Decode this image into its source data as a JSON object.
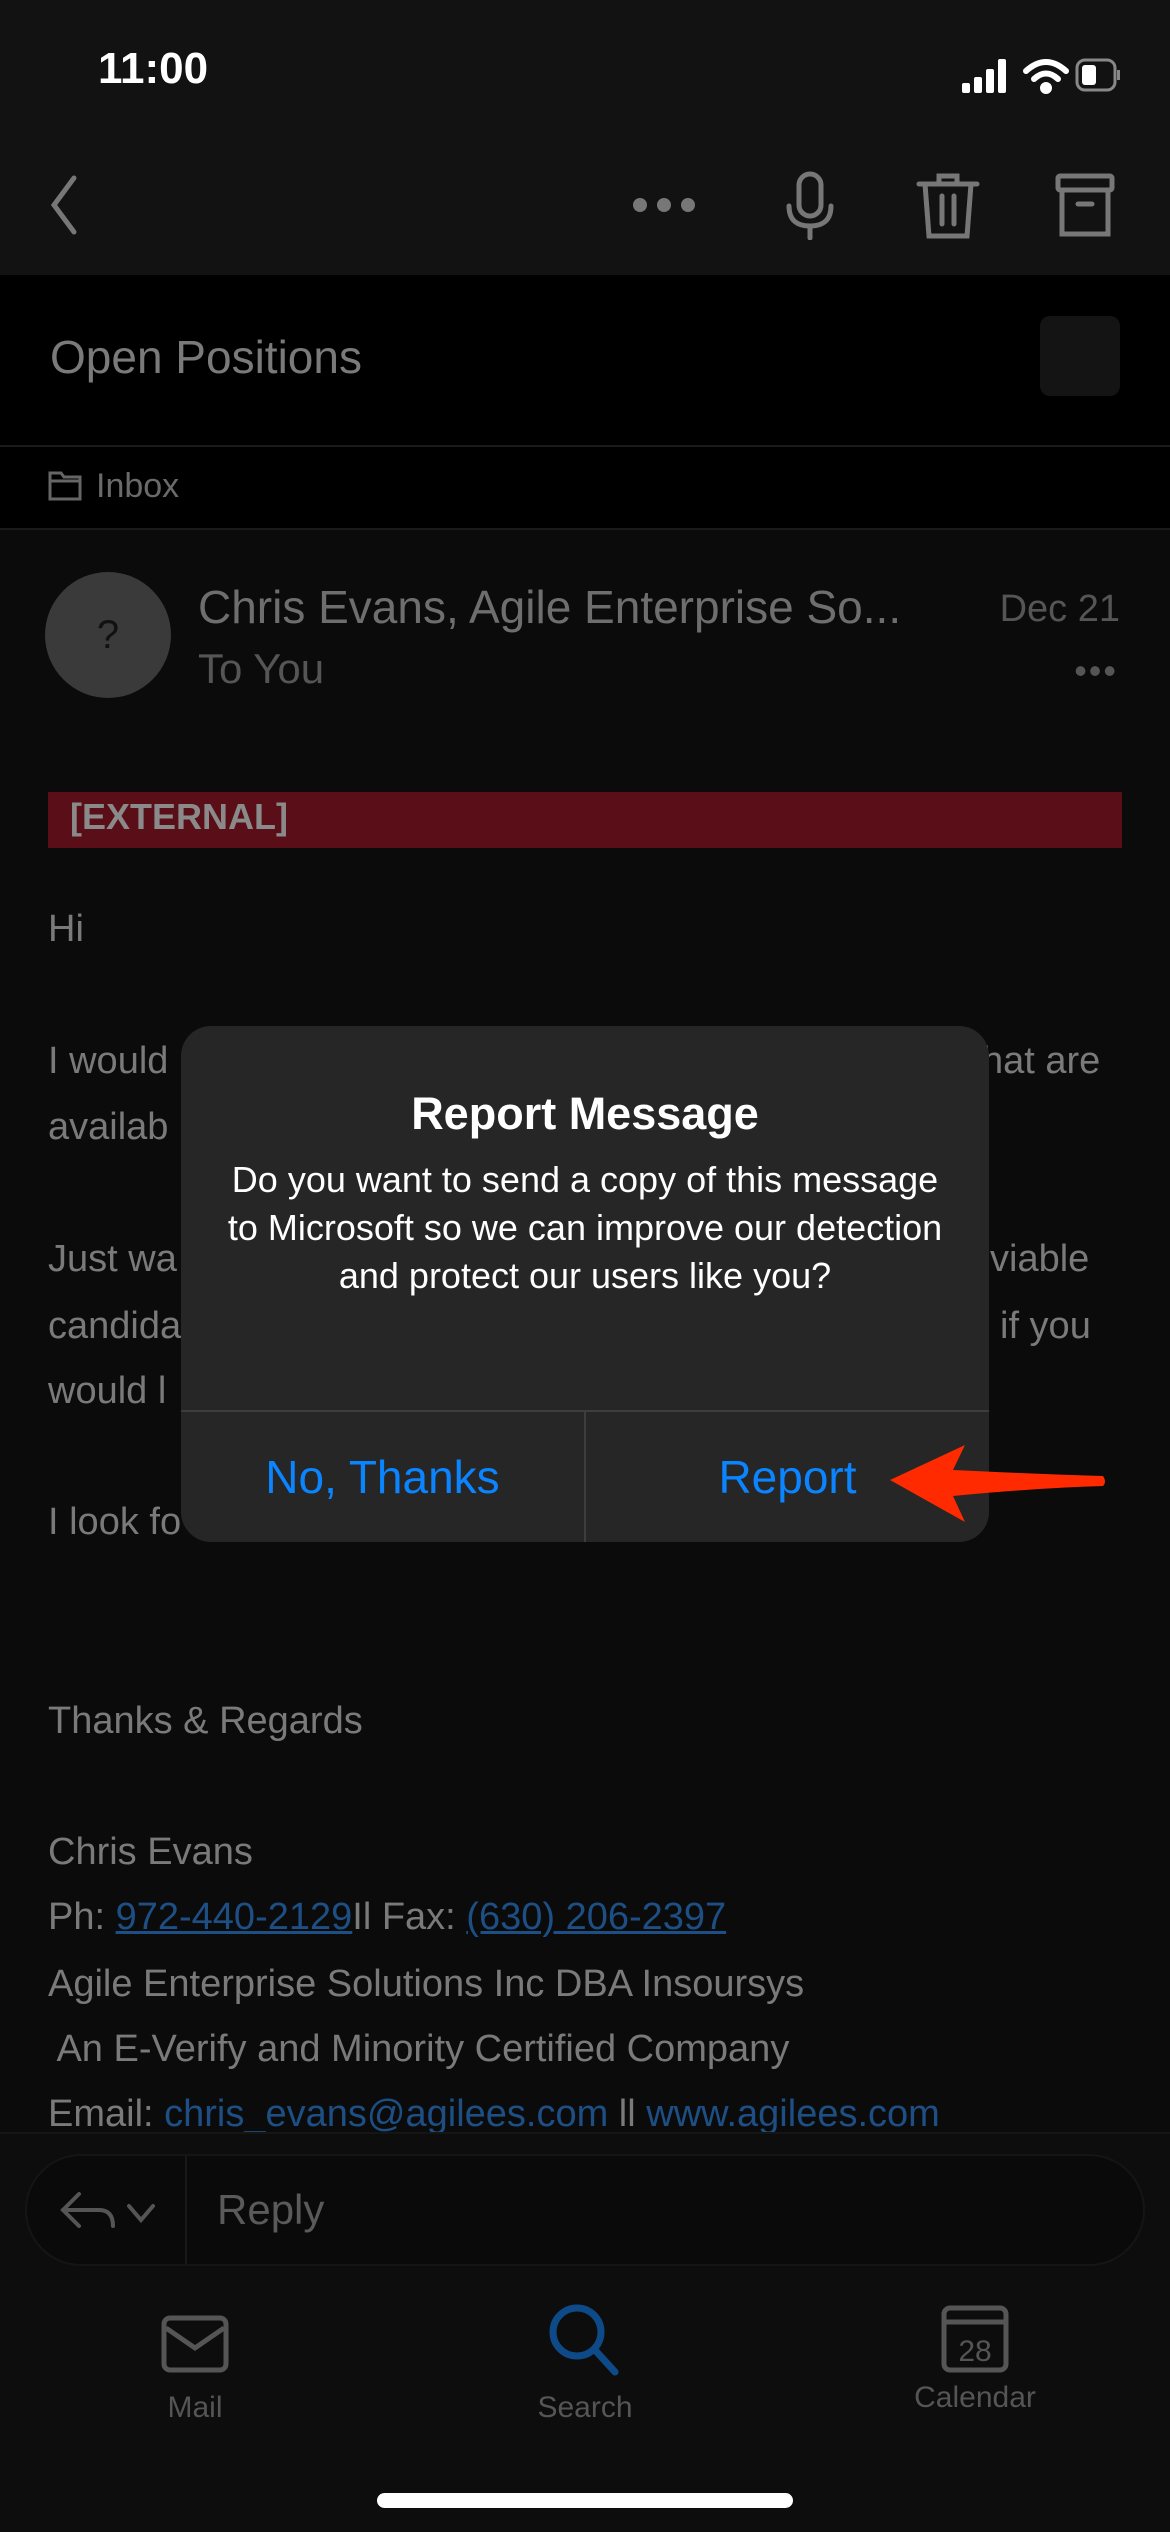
{
  "status_bar": {
    "time": "11:00",
    "icons": [
      "cellular-signal-icon",
      "wifi-icon",
      "battery-icon"
    ]
  },
  "toolbar": {
    "icons": [
      "back-chevron-icon",
      "more-icon",
      "microphone-icon",
      "trash-icon",
      "archive-icon"
    ]
  },
  "subject": "Open Positions",
  "folder": "Inbox",
  "message": {
    "avatar": "?",
    "sender": "Chris Evans, Agile Enterprise So...",
    "recipient": "To You",
    "date": "Dec 21",
    "more": "•••",
    "external_tag": "[EXTERNAL]",
    "body_left": [
      "Hi",
      "I would",
      "availab",
      "Just wa",
      "candida",
      "would l",
      "I look fo"
    ],
    "body_right": [
      "hat are",
      "viable",
      "if you"
    ],
    "closing": "Thanks & Regards",
    "sig_name": "Chris Evans",
    "ph_label": "Ph: ",
    "phone": "972-440-2129",
    "fax_label": "Il Fax: ",
    "fax": "(630) 206-2397",
    "company": "Agile Enterprise Solutions Inc DBA Insoursys",
    "tagline": " An E-Verify and Minority Certified Company",
    "email_label": "Email: ",
    "email": "chris_evans@agilees.com",
    "sep": " ll ",
    "website": "www.agilees.com"
  },
  "dialog": {
    "title": "Report Message",
    "message": "Do you want to send a copy of this message to Microsoft so we can improve our detection and protect our users like you?",
    "cancel": "No, Thanks",
    "confirm": "Report",
    "arrow_color": "#ff2a00"
  },
  "reply": {
    "placeholder": "Reply"
  },
  "tabs": [
    {
      "label": "Mail"
    },
    {
      "label": "Search",
      "active": true
    },
    {
      "label": "Calendar",
      "badge": "28"
    }
  ],
  "colors": {
    "accent": "#0a84ff",
    "external": "#5a0e18",
    "link": "#1d4f84"
  }
}
